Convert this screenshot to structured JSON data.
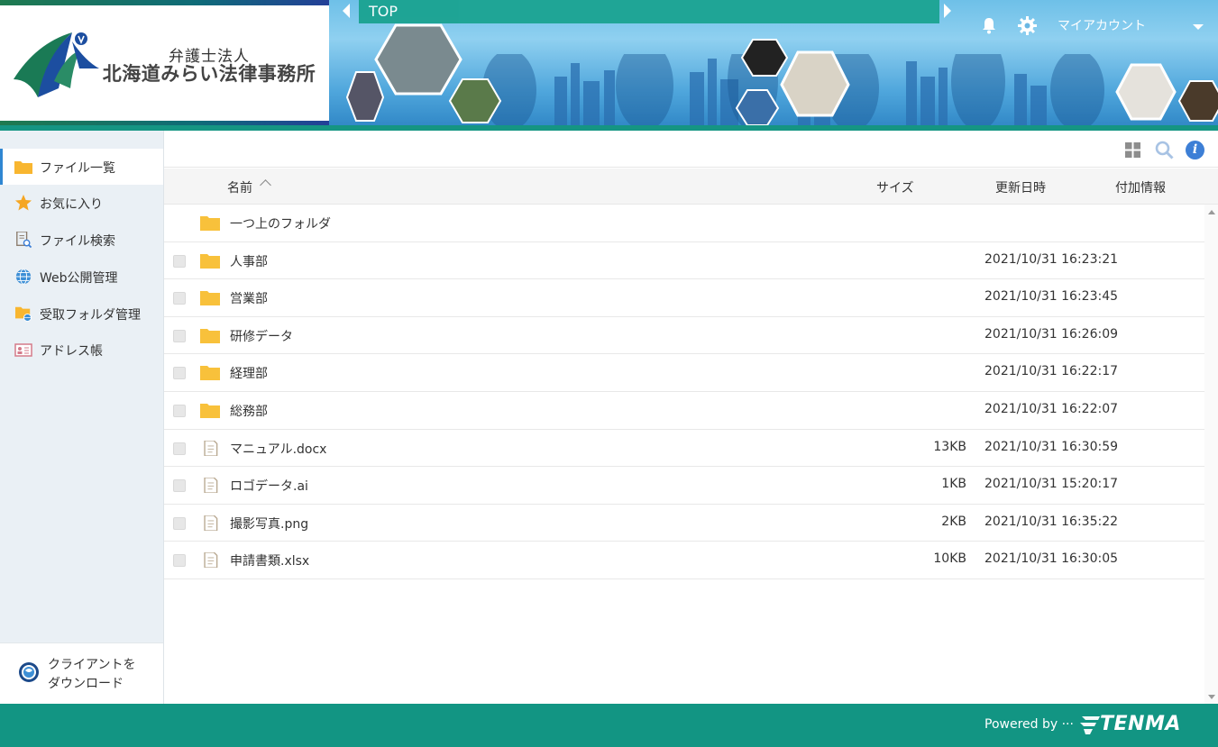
{
  "header": {
    "logo_subtitle": "弁護士法人",
    "logo_title": "北海道みらい法律事務所",
    "breadcrumb": "TOP",
    "account_label": "マイアカウント"
  },
  "sidebar": {
    "items": [
      {
        "label": "ファイル一覧",
        "icon": "folder-icon"
      },
      {
        "label": "お気に入り",
        "icon": "star-icon"
      },
      {
        "label": "ファイル検索",
        "icon": "file-search-icon"
      },
      {
        "label": "Web公開管理",
        "icon": "globe-icon"
      },
      {
        "label": "受取フォルダ管理",
        "icon": "receive-folder-icon"
      },
      {
        "label": "アドレス帳",
        "icon": "address-book-icon"
      }
    ],
    "download_line1": "クライアントを",
    "download_line2": "ダウンロード"
  },
  "table": {
    "columns": {
      "name": "名前",
      "size": "サイズ",
      "updated": "更新日時",
      "extra": "付加情報"
    },
    "parent_folder": "一つ上のフォルダ",
    "rows": [
      {
        "type": "folder",
        "name": "人事部",
        "size": "",
        "updated": "2021/10/31 16:23:21"
      },
      {
        "type": "folder",
        "name": "営業部",
        "size": "",
        "updated": "2021/10/31 16:23:45"
      },
      {
        "type": "folder",
        "name": "研修データ",
        "size": "",
        "updated": "2021/10/31 16:26:09"
      },
      {
        "type": "folder",
        "name": "経理部",
        "size": "",
        "updated": "2021/10/31 16:22:17"
      },
      {
        "type": "folder",
        "name": "総務部",
        "size": "",
        "updated": "2021/10/31 16:22:07"
      },
      {
        "type": "file",
        "name": "マニュアル.docx",
        "size": "13KB",
        "updated": "2021/10/31 16:30:59"
      },
      {
        "type": "file",
        "name": "ロゴデータ.ai",
        "size": "1KB",
        "updated": "2021/10/31 15:20:17"
      },
      {
        "type": "file",
        "name": "撮影写真.png",
        "size": "2KB",
        "updated": "2021/10/31 16:35:22"
      },
      {
        "type": "file",
        "name": "申請書類.xlsx",
        "size": "10KB",
        "updated": "2021/10/31 16:30:05"
      }
    ]
  },
  "footer": {
    "powered_by": "Powered by ···",
    "brand": "TENMA"
  },
  "colors": {
    "accent": "#129583",
    "folder": "#f8c13b",
    "nav_active": "#2f86d2",
    "info": "#3d7fd6"
  }
}
